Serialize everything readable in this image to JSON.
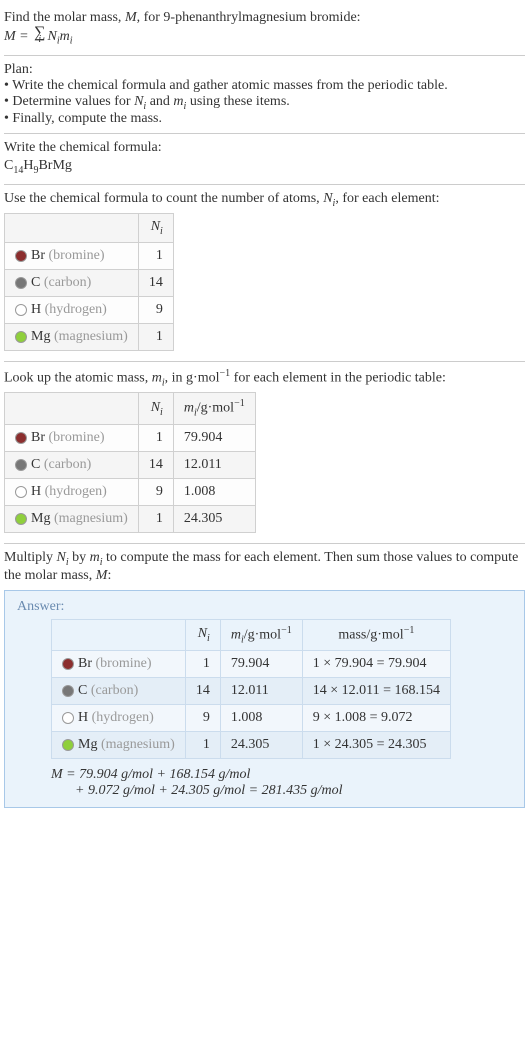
{
  "intro": {
    "line1_pre": "Find the molar mass, ",
    "line1_M": "M",
    "line1_post": ", for 9-phenanthrylmagnesium bromide:",
    "eq_lhs": "M = ",
    "eq_sigma": "∑",
    "eq_sigma_sub": "i",
    "eq_rhs_N": "N",
    "eq_rhs_i": "i",
    "eq_rhs_m": "m",
    "eq_rhs_i2": "i"
  },
  "plan": {
    "title": "Plan:",
    "b1": "• Write the chemical formula and gather atomic masses from the periodic table.",
    "b2_pre": "• Determine values for ",
    "b2_N": "N",
    "b2_i": "i",
    "b2_and": " and ",
    "b2_m": "m",
    "b2_i2": "i",
    "b2_post": " using these items.",
    "b3": "• Finally, compute the mass."
  },
  "chem": {
    "title": "Write the chemical formula:",
    "c": "C",
    "c14": "14",
    "h": "H",
    "h9": "9",
    "brmg": "BrMg"
  },
  "count": {
    "title_pre": "Use the chemical formula to count the number of atoms, ",
    "title_N": "N",
    "title_i": "i",
    "title_post": ", for each element:",
    "header_N": "N",
    "header_i": "i",
    "rows": [
      {
        "swatch": "#8b2e2e",
        "sym": "Br",
        "name": "(bromine)",
        "n": "1"
      },
      {
        "swatch": "#777777",
        "sym": "C",
        "name": "(carbon)",
        "n": "14"
      },
      {
        "swatch": "#ffffff",
        "sym": "H",
        "name": "(hydrogen)",
        "n": "9"
      },
      {
        "swatch": "#8fcf3c",
        "sym": "Mg",
        "name": "(magnesium)",
        "n": "1"
      }
    ]
  },
  "lookup": {
    "title_pre": "Look up the atomic mass, ",
    "title_m": "m",
    "title_i": "i",
    "title_mid": ", in g·mol",
    "title_exp": "−1",
    "title_post": " for each element in the periodic table:",
    "hdr_N": "N",
    "hdr_i": "i",
    "hdr_m": "m",
    "hdr_mi": "i",
    "hdr_unit": "/g·mol",
    "hdr_exp": "−1",
    "rows": [
      {
        "swatch": "#8b2e2e",
        "sym": "Br",
        "name": "(bromine)",
        "n": "1",
        "m": "79.904"
      },
      {
        "swatch": "#777777",
        "sym": "C",
        "name": "(carbon)",
        "n": "14",
        "m": "12.011"
      },
      {
        "swatch": "#ffffff",
        "sym": "H",
        "name": "(hydrogen)",
        "n": "9",
        "m": "1.008"
      },
      {
        "swatch": "#8fcf3c",
        "sym": "Mg",
        "name": "(magnesium)",
        "n": "1",
        "m": "24.305"
      }
    ]
  },
  "multiply": {
    "text_pre": "Multiply ",
    "N": "N",
    "Ni": "i",
    "by": " by ",
    "m": "m",
    "mi": "i",
    "text_post": " to compute the mass for each element. Then sum those values to compute the molar mass, ",
    "M": "M",
    "colon": ":"
  },
  "answer": {
    "label": "Answer:",
    "hdr_N": "N",
    "hdr_Ni": "i",
    "hdr_m": "m",
    "hdr_mi": "i",
    "hdr_unit": "/g·mol",
    "hdr_exp": "−1",
    "hdr_mass": "mass/g·mol",
    "hdr_mass_exp": "−1",
    "rows": [
      {
        "swatch": "#8b2e2e",
        "sym": "Br",
        "name": "(bromine)",
        "n": "1",
        "m": "79.904",
        "mass": "1 × 79.904 = 79.904"
      },
      {
        "swatch": "#777777",
        "sym": "C",
        "name": "(carbon)",
        "n": "14",
        "m": "12.011",
        "mass": "14 × 12.011 = 168.154"
      },
      {
        "swatch": "#ffffff",
        "sym": "H",
        "name": "(hydrogen)",
        "n": "9",
        "m": "1.008",
        "mass": "9 × 1.008 = 9.072"
      },
      {
        "swatch": "#8fcf3c",
        "sym": "Mg",
        "name": "(magnesium)",
        "n": "1",
        "m": "24.305",
        "mass": "1 × 24.305 = 24.305"
      }
    ],
    "final_M": "M",
    "final_1": " = 79.904 g/mol + 168.154 g/mol",
    "final_2": "+ 9.072 g/mol + 24.305 g/mol = 281.435 g/mol"
  }
}
